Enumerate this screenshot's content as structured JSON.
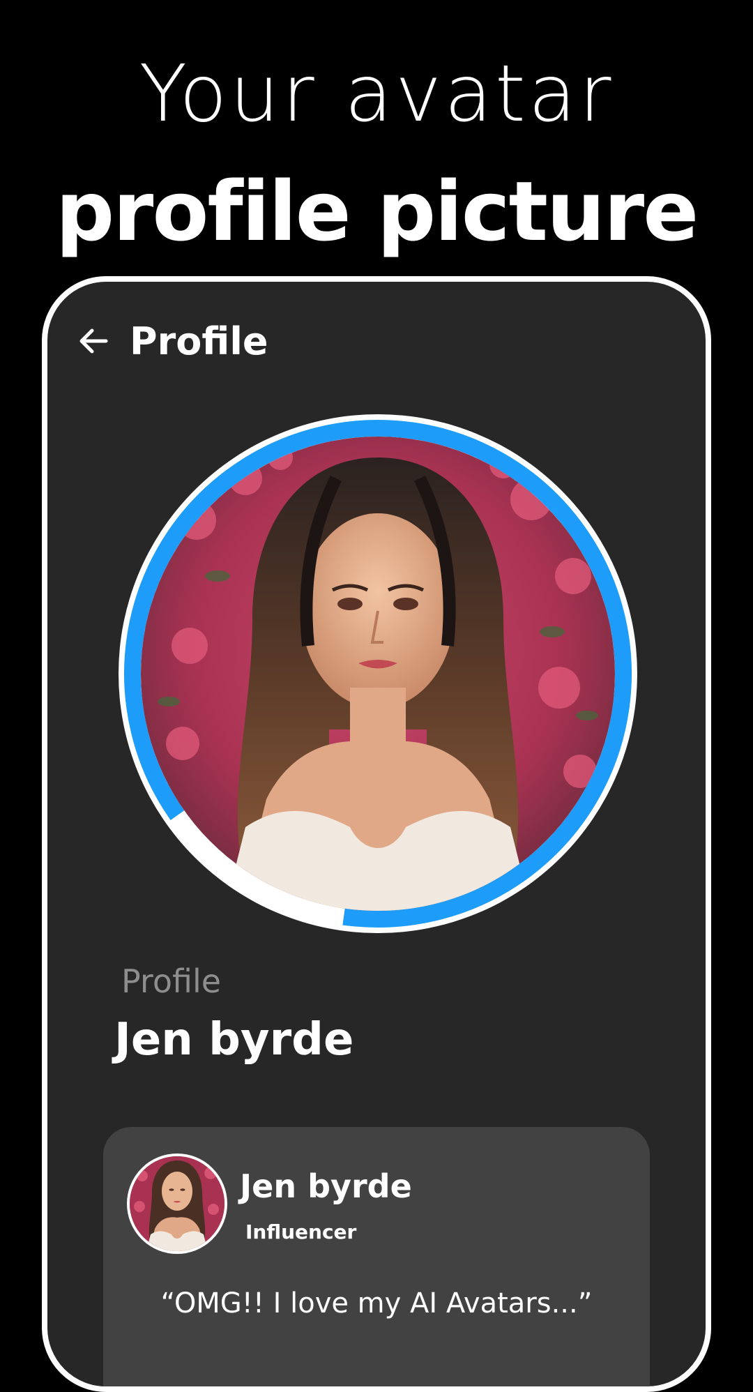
{
  "headline": {
    "line1": "Your avatar",
    "line2": "profile picture"
  },
  "app_bar": {
    "back_icon": "arrow-left-icon",
    "title": "Profile"
  },
  "avatar": {
    "progress_fraction": 0.87,
    "ring_color": "#1e9cf9",
    "track_color": "#ffffff"
  },
  "profile_field": {
    "label": "Profile",
    "value": "Jen byrde"
  },
  "review_card": {
    "name": "Jen byrde",
    "role": "Influencer",
    "quote": "“OMG!! I love my AI Avatars...”"
  }
}
